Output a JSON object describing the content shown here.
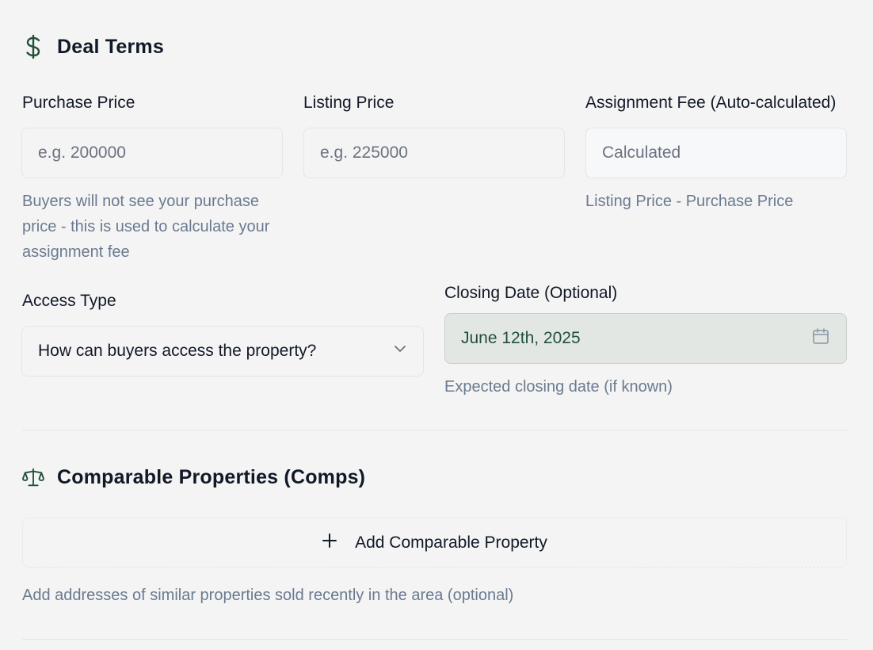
{
  "deal_terms": {
    "title": "Deal Terms",
    "icon": "dollar-sign-icon",
    "purchase_price": {
      "label": "Purchase Price",
      "placeholder": "e.g. 200000",
      "hint": "Buyers will not see your purchase price - this is used to calculate your assignment fee"
    },
    "listing_price": {
      "label": "Listing Price",
      "placeholder": "e.g. 225000"
    },
    "assignment_fee": {
      "label": "Assignment Fee (Auto-calculated)",
      "placeholder": "Calculated",
      "hint": "Listing Price - Purchase Price"
    },
    "access_type": {
      "label": "Access Type",
      "value": "How can buyers access the property?",
      "icon": "chevron-down-icon"
    },
    "closing_date": {
      "label": "Closing Date (Optional)",
      "value": "June 12th, 2025",
      "hint": "Expected closing date (if known)",
      "icon": "calendar-icon"
    }
  },
  "comps": {
    "title": "Comparable Properties (Comps)",
    "icon": "scale-icon",
    "add_button_label": "Add Comparable Property",
    "add_icon": "plus-icon",
    "hint": "Add addresses of similar properties sold recently in the area (optional)"
  },
  "colors": {
    "accent": "#21513a",
    "background": "#f4f4f4",
    "hint": "#6b7a90",
    "date_field_bg": "#e3e7e4"
  }
}
